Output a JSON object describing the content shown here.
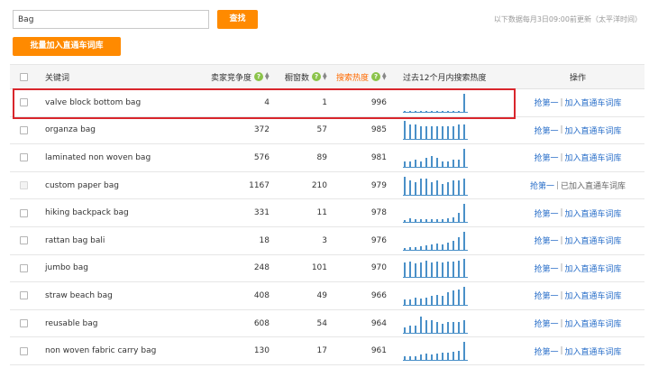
{
  "search": {
    "value": "Bag",
    "button_label": "查找"
  },
  "update_note": "以下数据每月3日09:00前更新（太平洋时间）",
  "batch_button_label": "批量加入直通车词库",
  "headers": {
    "keyword": "关键词",
    "competition": "卖家竞争度",
    "showcase": "橱窗数",
    "heat": "搜索热度",
    "trend": "过去12个月内搜索热度",
    "ops": "操作"
  },
  "rows": [
    {
      "keyword": "valve block bottom bag",
      "competition": "4",
      "showcase": "1",
      "heat": "996",
      "op1": "抢第一",
      "op2": "加入直通车词库",
      "added": false,
      "trend": [
        0,
        0,
        0,
        0,
        0,
        0,
        0,
        0,
        0,
        0,
        0,
        1.0
      ]
    },
    {
      "keyword": "organza bag",
      "competition": "372",
      "showcase": "57",
      "heat": "985",
      "op1": "抢第一",
      "op2": "加入直通车词库",
      "added": false,
      "trend": [
        1.0,
        0.8,
        0.8,
        0.7,
        0.7,
        0.7,
        0.7,
        0.7,
        0.7,
        0.7,
        0.8,
        0.8
      ]
    },
    {
      "keyword": "laminated non woven bag",
      "competition": "576",
      "showcase": "89",
      "heat": "981",
      "op1": "抢第一",
      "op2": "加入直通车词库",
      "added": false,
      "trend": [
        0.3,
        0.3,
        0.4,
        0.3,
        0.5,
        0.6,
        0.5,
        0.3,
        0.3,
        0.4,
        0.4,
        1.0
      ]
    },
    {
      "keyword": "custom paper bag",
      "competition": "1167",
      "showcase": "210",
      "heat": "979",
      "op1": "抢第一",
      "op2": "已加入直通车词库",
      "added": true,
      "trend": [
        1.0,
        0.8,
        0.7,
        0.9,
        0.9,
        0.7,
        0.8,
        0.6,
        0.7,
        0.8,
        0.8,
        0.9
      ]
    },
    {
      "keyword": "hiking backpack bag",
      "competition": "331",
      "showcase": "11",
      "heat": "978",
      "op1": "抢第一",
      "op2": "加入直通车词库",
      "added": false,
      "trend": [
        0.1,
        0.2,
        0.15,
        0.15,
        0.15,
        0.15,
        0.15,
        0.15,
        0.2,
        0.25,
        0.5,
        1.0
      ]
    },
    {
      "keyword": "rattan bag bali",
      "competition": "18",
      "showcase": "3",
      "heat": "976",
      "op1": "抢第一",
      "op2": "加入直通车词库",
      "added": false,
      "trend": [
        0.1,
        0.15,
        0.15,
        0.2,
        0.25,
        0.3,
        0.35,
        0.3,
        0.4,
        0.5,
        0.7,
        1.0
      ]
    },
    {
      "keyword": "jumbo bag",
      "competition": "248",
      "showcase": "101",
      "heat": "970",
      "op1": "抢第一",
      "op2": "加入直通车词库",
      "added": false,
      "trend": [
        0.8,
        0.85,
        0.75,
        0.8,
        0.9,
        0.8,
        0.85,
        0.8,
        0.85,
        0.85,
        0.9,
        1.0
      ]
    },
    {
      "keyword": "straw beach bag",
      "competition": "408",
      "showcase": "49",
      "heat": "966",
      "op1": "抢第一",
      "op2": "加入直通车词库",
      "added": false,
      "trend": [
        0.3,
        0.3,
        0.4,
        0.35,
        0.4,
        0.5,
        0.55,
        0.5,
        0.7,
        0.8,
        0.85,
        1.0
      ]
    },
    {
      "keyword": "reusable bag",
      "competition": "608",
      "showcase": "54",
      "heat": "964",
      "op1": "抢第一",
      "op2": "加入直通车词库",
      "added": false,
      "trend": [
        0.3,
        0.4,
        0.4,
        0.9,
        0.7,
        0.7,
        0.6,
        0.5,
        0.6,
        0.6,
        0.6,
        0.7
      ]
    },
    {
      "keyword": "non woven fabric carry bag",
      "competition": "130",
      "showcase": "17",
      "heat": "961",
      "op1": "抢第一",
      "op2": "加入直通车词库",
      "added": false,
      "trend": [
        0.2,
        0.2,
        0.2,
        0.3,
        0.35,
        0.3,
        0.35,
        0.4,
        0.4,
        0.45,
        0.5,
        1.0
      ]
    }
  ],
  "op_separator": "|",
  "colors": {
    "accent": "#ff8a00",
    "link": "#2a6fc9",
    "bar": "#4a90c8",
    "highlight": "#d9262c",
    "help": "#8bc34a"
  }
}
